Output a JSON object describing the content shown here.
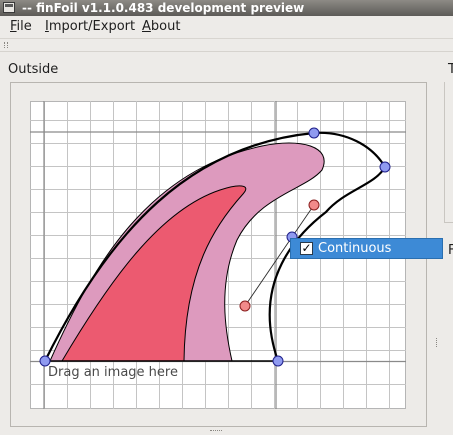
{
  "window": {
    "title": "-- finFoil v1.1.0.483 development preview"
  },
  "menu": {
    "items": [
      {
        "mnemonic": "F",
        "rest": "ile"
      },
      {
        "mnemonic": "I",
        "rest": "mport/Export"
      },
      {
        "mnemonic": "A",
        "rest": "bout"
      }
    ]
  },
  "editor": {
    "section_label": "Outside",
    "right_label_top": "T",
    "right_label_mid": "F",
    "drop_hint": "Drag an image here",
    "outline_color": "#000000",
    "fill_outer_color": "#dd9abe",
    "fill_inner_color": "#ec5a70",
    "point_color": "#8f9af0",
    "control_point_color": "#f28a8a"
  },
  "context_menu": {
    "checked": true,
    "check_mark": "✓",
    "label": "Continuous",
    "highlight_color": "#3d8ad6"
  }
}
